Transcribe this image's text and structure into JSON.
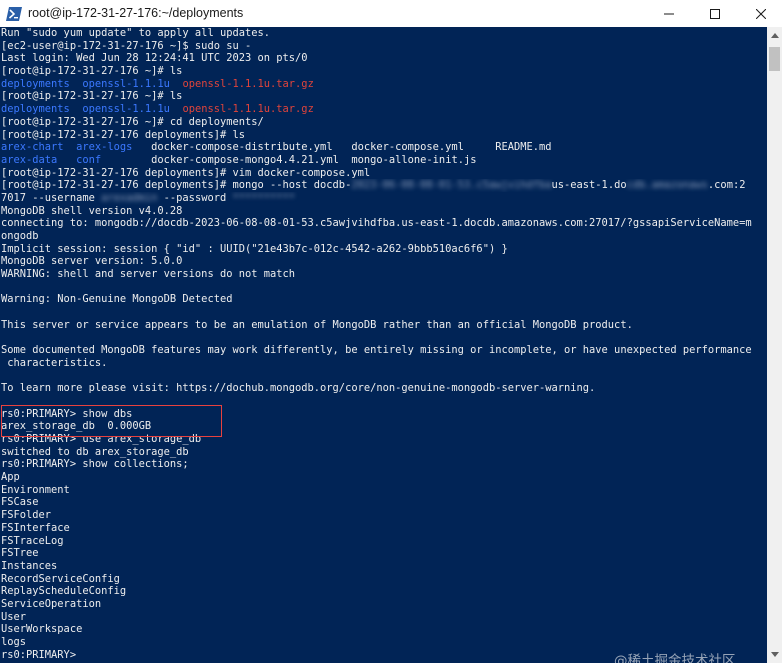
{
  "window": {
    "title": "root@ip-172-31-27-176:~/deployments",
    "icon": "powershell-icon"
  },
  "colors": {
    "console_bg": "#012456",
    "text": "#eeeeee",
    "dir_blue": "#3b78ff",
    "archive_red": "#e0443b",
    "highlight_border": "#e8413e"
  },
  "terminal": {
    "lines": [
      [
        {
          "t": "Run \"sudo yum update\" to apply all updates."
        }
      ],
      [
        {
          "t": "[ec2-user@ip-172-31-27-176 ~]$ sudo su -"
        }
      ],
      [
        {
          "t": "Last login: Wed Jun 28 12:24:41 UTC 2023 on pts/0"
        }
      ],
      [
        {
          "t": "[root@ip-172-31-27-176 ~]# ls"
        }
      ],
      [
        {
          "t": "deployments",
          "c": "blue"
        },
        {
          "t": "  "
        },
        {
          "t": "openssl-1.1.1u",
          "c": "blue"
        },
        {
          "t": "  "
        },
        {
          "t": "openssl-1.1.1u.tar.gz",
          "c": "red"
        }
      ],
      [
        {
          "t": "[root@ip-172-31-27-176 ~]# ls"
        }
      ],
      [
        {
          "t": "deployments",
          "c": "blue"
        },
        {
          "t": "  "
        },
        {
          "t": "openssl-1.1.1u",
          "c": "blue"
        },
        {
          "t": "  "
        },
        {
          "t": "openssl-1.1.1u.tar.gz",
          "c": "red"
        }
      ],
      [
        {
          "t": "[root@ip-172-31-27-176 ~]# cd deployments/"
        }
      ],
      [
        {
          "t": "[root@ip-172-31-27-176 deployments]# ls"
        }
      ],
      [
        {
          "t": "arex-chart",
          "c": "blue"
        },
        {
          "t": "  "
        },
        {
          "t": "arex-logs",
          "c": "blue"
        },
        {
          "t": "   docker-compose-distribute.yml   docker-compose.yml     README.md"
        }
      ],
      [
        {
          "t": "arex-data",
          "c": "blue"
        },
        {
          "t": "   "
        },
        {
          "t": "conf",
          "c": "blue"
        },
        {
          "t": "        docker-compose-mongo4.4.21.yml  mongo-allone-init.js"
        }
      ],
      [
        {
          "t": "[root@ip-172-31-27-176 deployments]# vim docker-compose.yml"
        }
      ],
      [
        {
          "t": "[root@ip-172-31-27-176 deployments]# mongo --host docdb-"
        },
        {
          "t": "2023-06-08-08-01-53.c5awjvihdfba",
          "c": "blur"
        },
        {
          "t": "us-east-1.do"
        },
        {
          "t": "cdb.amazonaws",
          "c": "blur"
        },
        {
          "t": ".com:2"
        }
      ],
      [
        {
          "t": "7017 --username "
        },
        {
          "t": "arexadmin",
          "c": "blur"
        },
        {
          "t": " --password "
        },
        {
          "t": "**********",
          "c": "blur"
        }
      ],
      [
        {
          "t": "MongoDB shell version v4.0.28"
        }
      ],
      [
        {
          "t": "connecting to: mongodb://docdb-2023-06-08-08-01-53.c5awjvihdfba.us-east-1.docdb.amazonaws.com:27017/?gssapiServiceName=m"
        }
      ],
      [
        {
          "t": "ongodb"
        }
      ],
      [
        {
          "t": "Implicit session: session { \"id\" : UUID(\"21e43b7c-012c-4542-a262-9bbb510ac6f6\") }"
        }
      ],
      [
        {
          "t": "MongoDB server version: 5.0.0"
        }
      ],
      [
        {
          "t": "WARNING: shell and server versions do not match"
        }
      ],
      [
        {
          "t": ""
        }
      ],
      [
        {
          "t": "Warning: Non-Genuine MongoDB Detected"
        }
      ],
      [
        {
          "t": ""
        }
      ],
      [
        {
          "t": "This server or service appears to be an emulation of MongoDB rather than an official MongoDB product."
        }
      ],
      [
        {
          "t": ""
        }
      ],
      [
        {
          "t": "Some documented MongoDB features may work differently, be entirely missing or incomplete, or have unexpected performance"
        }
      ],
      [
        {
          "t": " characteristics."
        }
      ],
      [
        {
          "t": ""
        }
      ],
      [
        {
          "t": "To learn more please visit: https://dochub.mongodb.org/core/non-genuine-mongodb-server-warning."
        }
      ],
      [
        {
          "t": ""
        }
      ],
      [
        {
          "t": "rs0:PRIMARY> show dbs"
        }
      ],
      [
        {
          "t": "arex_storage_db  0.000GB"
        }
      ],
      [
        {
          "t": "rs0:PRIMARY> use arex_storage_db"
        }
      ],
      [
        {
          "t": "switched to db arex_storage_db"
        }
      ],
      [
        {
          "t": "rs0:PRIMARY> show collections;"
        }
      ],
      [
        {
          "t": "App"
        }
      ],
      [
        {
          "t": "Environment"
        }
      ],
      [
        {
          "t": "FSCase"
        }
      ],
      [
        {
          "t": "FSFolder"
        }
      ],
      [
        {
          "t": "FSInterface"
        }
      ],
      [
        {
          "t": "FSTraceLog"
        }
      ],
      [
        {
          "t": "FSTree"
        }
      ],
      [
        {
          "t": "Instances"
        }
      ],
      [
        {
          "t": "RecordServiceConfig"
        }
      ],
      [
        {
          "t": "ReplayScheduleConfig"
        }
      ],
      [
        {
          "t": "ServiceOperation"
        }
      ],
      [
        {
          "t": "User"
        }
      ],
      [
        {
          "t": "UserWorkspace"
        }
      ],
      [
        {
          "t": "logs"
        }
      ],
      [
        {
          "t": "rs0:PRIMARY>"
        }
      ]
    ]
  },
  "watermark": "@稀土掘金技术社区"
}
